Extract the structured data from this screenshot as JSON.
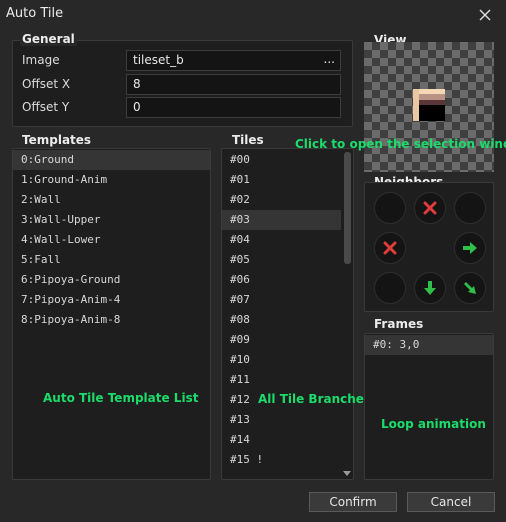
{
  "window": {
    "title": "Auto Tile"
  },
  "general": {
    "heading": "General",
    "image_label": "Image",
    "image_value": "tileset_b",
    "browse_label": "...",
    "offset_x_label": "Offset X",
    "offset_x_value": "8",
    "offset_y_label": "Offset Y",
    "offset_y_value": "0"
  },
  "view": {
    "heading": "View",
    "annotation": "Click to open the selection window"
  },
  "templates": {
    "heading": "Templates",
    "items": [
      "0:Ground",
      "1:Ground-Anim",
      "2:Wall",
      "3:Wall-Upper",
      "4:Wall-Lower",
      "5:Fall",
      "6:Pipoya-Ground",
      "7:Pipoya-Anim-4",
      "8:Pipoya-Anim-8"
    ],
    "selected_index": 0,
    "annotation": "Auto Tile Template List"
  },
  "tiles": {
    "heading": "Tiles",
    "items": [
      "#00",
      "#01",
      "#02",
      "#03",
      "#04",
      "#05",
      "#06",
      "#07",
      "#08",
      "#09",
      "#10",
      "#11",
      "#12",
      "#13",
      "#14",
      "#15 !"
    ],
    "selected_index": 3,
    "annotation": "All Tile Branches"
  },
  "neighbors": {
    "heading": "Neighbors",
    "cells": [
      "empty",
      "cross-icon",
      "empty",
      "cross-icon",
      "arrow-right-icon",
      "empty",
      "arrow-down-icon",
      "arrow-down-right-icon"
    ],
    "colors": {
      "cross": "#e03c3c",
      "arrow": "#2fbf4a"
    }
  },
  "frames": {
    "heading": "Frames",
    "items": [
      "#0: 3,0"
    ],
    "annotation": "Loop animation"
  },
  "buttons": {
    "confirm": "Confirm",
    "cancel": "Cancel"
  }
}
